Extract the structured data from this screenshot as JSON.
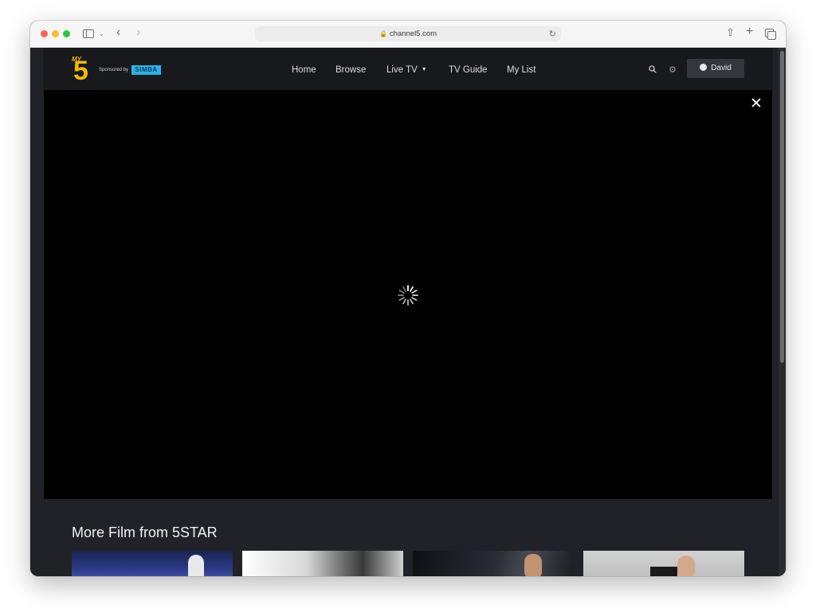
{
  "browser": {
    "url": "channel5.com"
  },
  "header": {
    "logo_text": "5",
    "logo_small": "MY",
    "sponsored_text": "Sponsored by",
    "sponsor_name": "SIMBA",
    "nav": {
      "home": "Home",
      "browse": "Browse",
      "live_tv": "Live TV",
      "tv_guide": "TV Guide",
      "my_list": "My List"
    },
    "user_name": "David"
  },
  "player": {
    "close_glyph": "✕",
    "state": "loading"
  },
  "row": {
    "title": "More Film from 5STAR"
  },
  "colors": {
    "page_bg": "#202227",
    "header_bg": "#17191c",
    "logo_yellow": "#f5b800",
    "sponsor_blue": "#2bb3e5"
  }
}
